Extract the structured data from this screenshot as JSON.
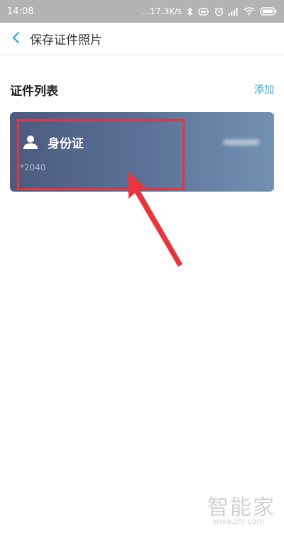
{
  "status_bar": {
    "time": "14:08",
    "network_speed": "...17.3K/s",
    "icons": [
      "bluetooth-icon",
      "battery-saver-icon",
      "alarm-icon",
      "signal-icon",
      "wifi-icon",
      "battery-icon"
    ]
  },
  "nav": {
    "back_icon": "chevron-left-icon",
    "title": "保存证件照片"
  },
  "section": {
    "title": "证件列表",
    "add_label": "添加"
  },
  "cards": [
    {
      "icon": "person-icon",
      "name": "身份证",
      "number": "*2040",
      "gradient": [
        "#4c5b80",
        "#7391b2"
      ]
    }
  ],
  "annotation": {
    "highlight_color": "#e8343a"
  },
  "watermark": {
    "brand": "智能家",
    "url": "www.znj.com"
  },
  "colors": {
    "accent": "#2ea7e0",
    "status_bar_bg": "#b3b3b3"
  }
}
